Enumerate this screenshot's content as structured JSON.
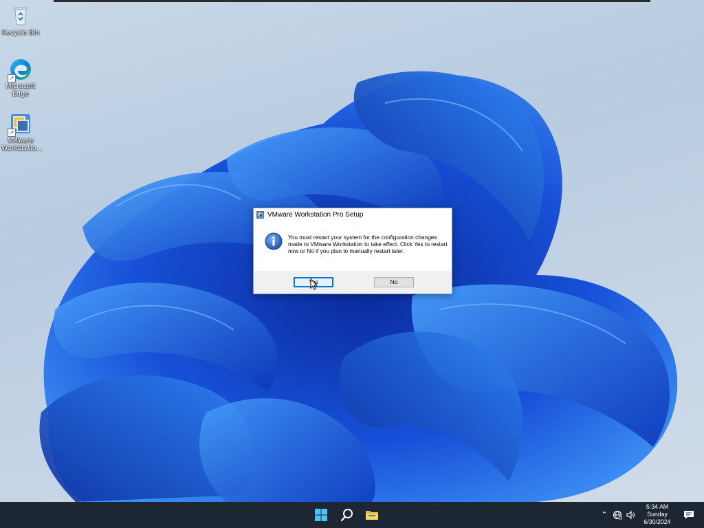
{
  "desktop": {
    "icons": [
      {
        "name": "recycle-bin",
        "label": "Recycle Bin"
      },
      {
        "name": "microsoft-edge",
        "label": "Microsoft\nEdge"
      },
      {
        "name": "vmware-workstation",
        "label": "VMware\nWorkstatio..."
      }
    ]
  },
  "dialog": {
    "title": "VMware Workstation Pro Setup",
    "message": "You must restart your system for the configuration changes made to VMware Workstation to take effect. Click Yes to restart now or No if you plan to manually restart later.",
    "icon": "info-icon",
    "yes_label": "Yes",
    "no_label": "No"
  },
  "taskbar": {
    "apps": [
      "start-icon",
      "search-icon",
      "file-explorer-icon"
    ],
    "tray_icons": [
      "chevron-up-icon",
      "network-icon",
      "speaker-icon"
    ],
    "clock": {
      "time": "5:34 AM",
      "day": "Sunday",
      "date": "6/30/2024"
    },
    "notification_icon": "notification-icon"
  },
  "colors": {
    "taskbar_bg": "#1c2733",
    "dialog_accent": "#0078d7",
    "wallpaper_blue": "#1a5ee8"
  }
}
